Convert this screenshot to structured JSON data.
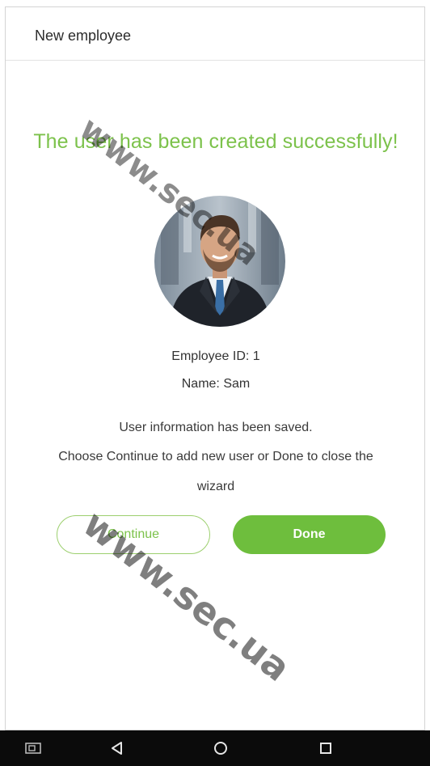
{
  "header": {
    "title": "New employee"
  },
  "success_message": "The user has been created successfully!",
  "employee": {
    "id_label": "Employee ID:",
    "id_value": "1",
    "name_label": "Name:",
    "name_value": "Sam"
  },
  "info": {
    "line1": "User information has been saved.",
    "line2": "Choose Continue to add new user or Done to close the",
    "line3": "wizard"
  },
  "buttons": {
    "continue_label": "Continue",
    "done_label": "Done"
  },
  "watermark": {
    "text_top": "www.sec.ua",
    "text_bottom": "www.sec.ua"
  },
  "nav": {
    "icons": [
      "screenshot-icon",
      "back-icon",
      "home-icon",
      "recent-apps-icon"
    ]
  },
  "colors": {
    "accent_green": "#7cc24b",
    "button_green": "#6ebe3d",
    "nav_background": "#0b0b0b"
  }
}
